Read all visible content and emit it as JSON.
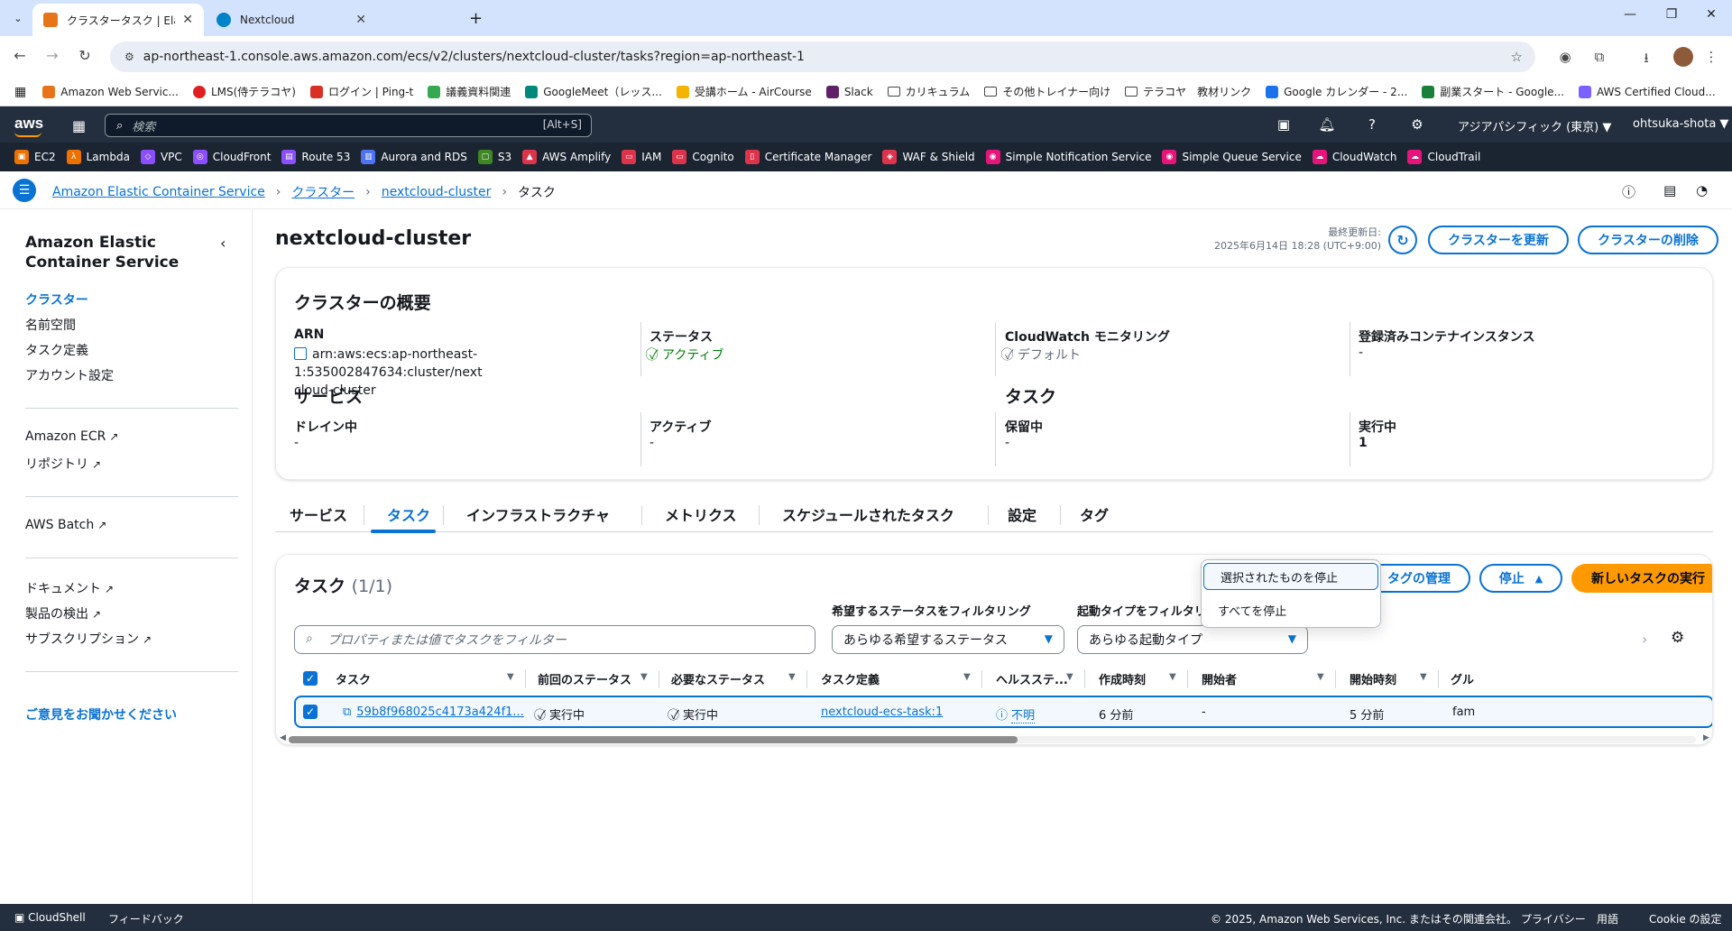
{
  "browser": {
    "tabs": [
      {
        "title": "クラスタータスク | Elastic Container",
        "favicon_color": "#e8741a",
        "active": true
      },
      {
        "title": "Nextcloud",
        "favicon_color": "#0082c9",
        "active": false
      }
    ],
    "new_tab_symbol": "+",
    "close_symbol": "✕",
    "url": "ap-northeast-1.console.aws.amazon.com/ecs/v2/clusters/nextcloud-cluster/tasks?region=ap-northeast-1",
    "window_controls": {
      "minimize": "—",
      "restore": "❐",
      "close": "✕"
    },
    "bookmarks": [
      {
        "label": "Amazon Web Servic...",
        "color": "#e8741a",
        "type": "site"
      },
      {
        "label": "LMS(侍テラコヤ)",
        "color": "#e02020",
        "type": "site"
      },
      {
        "label": "ログイン | Ping-t",
        "color": "#d93025",
        "type": "site"
      },
      {
        "label": "議義資料関連",
        "color": "#34a853",
        "type": "site"
      },
      {
        "label": "GoogleMeet（レッス...",
        "color": "#00897b",
        "type": "site"
      },
      {
        "label": "受講ホーム - AirCourse",
        "color": "#f4b400",
        "type": "site"
      },
      {
        "label": "Slack",
        "color": "#611f69",
        "type": "site"
      },
      {
        "label": "カリキュラム",
        "type": "folder"
      },
      {
        "label": "その他トレイナー向け",
        "type": "folder"
      },
      {
        "label": "テラコヤ　教材リンク",
        "type": "folder"
      },
      {
        "label": "Google カレンダー - 2...",
        "color": "#1a73e8",
        "type": "site"
      },
      {
        "label": "副業スタート - Google...",
        "color": "#188038",
        "type": "site"
      },
      {
        "label": "AWS Certified Cloud...",
        "color": "#7b61ff",
        "type": "site"
      }
    ]
  },
  "aws": {
    "logo": "aws",
    "search_placeholder": "検索",
    "search_shortcut": "[Alt+S]",
    "region": "アジアパシフィック (東京) ▼",
    "user": "ohtsuka-shota ▼",
    "favorites": [
      {
        "label": "EC2",
        "color": "#ed7100"
      },
      {
        "label": "Lambda",
        "color": "#ed7100"
      },
      {
        "label": "VPC",
        "color": "#8c4fff"
      },
      {
        "label": "CloudFront",
        "color": "#8c4fff"
      },
      {
        "label": "Route 53",
        "color": "#8c4fff"
      },
      {
        "label": "Aurora and RDS",
        "color": "#4d72f3"
      },
      {
        "label": "S3",
        "color": "#3f8624"
      },
      {
        "label": "AWS Amplify",
        "color": "#dd344c"
      },
      {
        "label": "IAM",
        "color": "#dd344c"
      },
      {
        "label": "Cognito",
        "color": "#dd344c"
      },
      {
        "label": "Certificate Manager",
        "color": "#dd344c"
      },
      {
        "label": "WAF & Shield",
        "color": "#dd344c"
      },
      {
        "label": "Simple Notification Service",
        "color": "#e7157b"
      },
      {
        "label": "Simple Queue Service",
        "color": "#e7157b"
      },
      {
        "label": "CloudWatch",
        "color": "#e7157b"
      },
      {
        "label": "CloudTrail",
        "color": "#e7157b"
      }
    ]
  },
  "breadcrumb": {
    "items": [
      "Amazon Elastic Container Service",
      "クラスター",
      "nextcloud-cluster"
    ],
    "current": "タスク"
  },
  "sidenav": {
    "title": "Amazon Elastic Container Service",
    "items": [
      "クラスター",
      "名前空間",
      "タスク定義",
      "アカウント設定"
    ],
    "ecr": "Amazon ECR",
    "repo": "リポジトリ",
    "batch": "AWS Batch",
    "docs": "ドキュメント",
    "products": "製品の検出",
    "subs": "サブスクリプション",
    "feedback": "ご意見をお聞かせください"
  },
  "page": {
    "title": "nextcloud-cluster",
    "last_updated_label": "最終更新日:",
    "last_updated_value": "2025年6月14日 18:28 (UTC+9:00)",
    "update_button": "クラスターを更新",
    "delete_button": "クラスターの削除"
  },
  "overview": {
    "title": "クラスターの概要",
    "arn_label": "ARN",
    "arn_line1": "arn:aws:ecs:ap-northeast-1:535002847634:cluster/next",
    "arn_line2": "cloud-cluster",
    "status_label": "ステータス",
    "status_value": "アクティブ",
    "cw_label": "CloudWatch モニタリング",
    "cw_value": "デフォルト",
    "instances_label": "登録済みコンテナインスタンス",
    "instances_value": "-",
    "services_title": "サービス",
    "draining_label": "ドレイン中",
    "draining_value": "-",
    "active_label": "アクティブ",
    "active_value": "-",
    "tasks_title": "タスク",
    "pending_label": "保留中",
    "pending_value": "-",
    "running_label": "実行中",
    "running_value": "1"
  },
  "tabs": [
    "サービス",
    "タスク",
    "インフラストラクチャ",
    "メトリクス",
    "スケジュールされたタスク",
    "設定",
    "タグ"
  ],
  "tasks": {
    "title": "タスク",
    "count": "(1/1)",
    "manage_tags": "タグの管理",
    "stop": "停止",
    "run_new": "新しいタスクの実行",
    "status_filter_label": "希望するステータスをフィルタリング",
    "launch_filter_label": "起動タイプをフィルタリング",
    "search_placeholder": "プロパティまたは値でタスクをフィルター",
    "status_filter_value": "あらゆる希望するステータス",
    "launch_filter_value": "あらゆる起動タイプ",
    "columns": [
      "タスク",
      "前回のステータス",
      "必要なステータス",
      "タスク定義",
      "ヘルスステ...",
      "作成時刻",
      "開始者",
      "開始時刻",
      "グル"
    ],
    "row": {
      "task": "59b8f968025c4173a424f1...",
      "last_status": "実行中",
      "desired_status": "実行中",
      "task_def": "nextcloud-ecs-task:1",
      "health": "不明",
      "created": "6 分前",
      "started_by": "-",
      "started": "5 分前",
      "group": "fam"
    },
    "dropdown": [
      "選択されたものを停止",
      "すべてを停止"
    ]
  },
  "footer": {
    "cloudshell": "CloudShell",
    "feedback": "フィードバック",
    "copyright": "© 2025, Amazon Web Services, Inc. またはその関連会社。",
    "privacy": "プライバシー",
    "terms": "用語",
    "cookie": "Cookie の設定"
  }
}
